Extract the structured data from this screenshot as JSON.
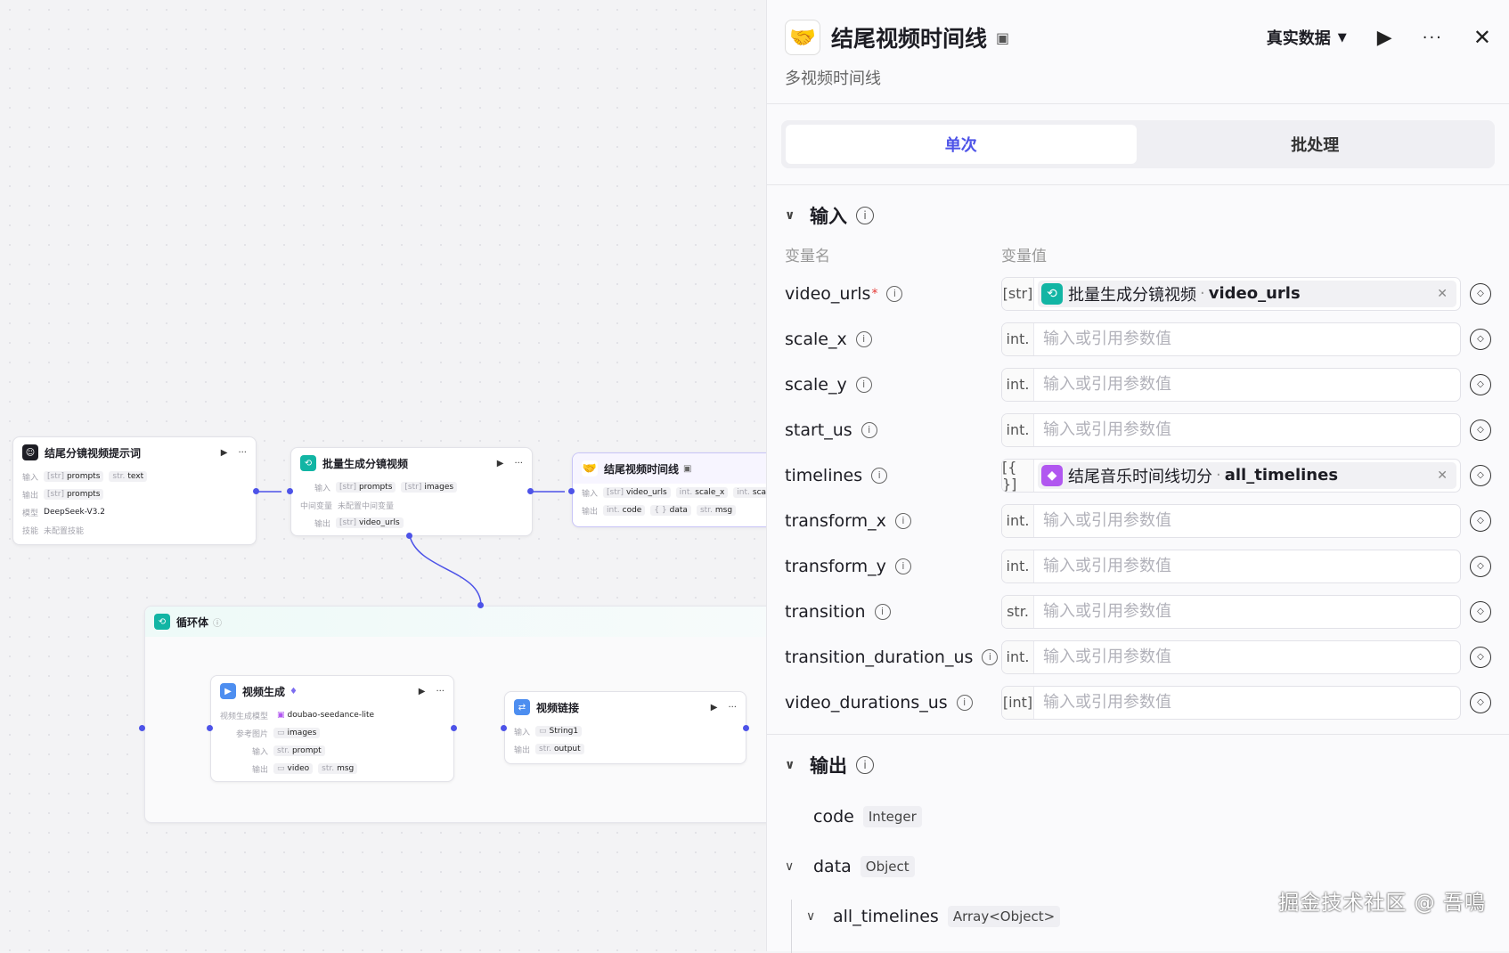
{
  "canvas": {
    "node_prompt": {
      "title": "结尾分镜视频提示词",
      "icon": "robot-icon",
      "input_label": "输入",
      "input_tag_type": "[str]",
      "input_tag": "prompts",
      "input_tag2_type": "str.",
      "input_tag2": "text",
      "output_label": "输出",
      "output_tag_type": "[str]",
      "output_tag": "prompts",
      "model_label": "模型",
      "model_value": "DeepSeek-V3.2",
      "skill_label": "技能",
      "skill_value": "未配置技能"
    },
    "node_batch": {
      "title": "批量生成分镜视频",
      "input_label": "输入",
      "input_tag_type": "[str]",
      "input_tag": "prompts",
      "input_tag2_type": "[str]",
      "input_tag2": "images",
      "mid_label": "中间变量",
      "mid_value": "未配置中间变量",
      "output_label": "输出",
      "output_tag_type": "[str]",
      "output_tag": "video_urls"
    },
    "node_timeline": {
      "title": "结尾视频时间线",
      "input_label": "输入",
      "t1_type": "[str]",
      "t1": "video_urls",
      "t2_type": "int.",
      "t2": "scale_x",
      "t3_type": "int.",
      "t3": "scale_y",
      "output_label": "输出",
      "o1_type": "int.",
      "o1": "code",
      "o2_type": "{ }",
      "o2": "data",
      "o3_type": "str.",
      "o3": "msg"
    },
    "loop": {
      "title": "循环体"
    },
    "node_video": {
      "title": "视频生成",
      "model_label": "视频生成模型",
      "model_value": "doubao-seedance-lite",
      "ref_label": "参考图片",
      "ref_value": "images",
      "input_label": "输入",
      "input_tag_type": "str.",
      "input_tag": "prompt",
      "output_label": "输出",
      "o1": "video",
      "o2_type": "str.",
      "o2": "msg"
    },
    "node_link": {
      "title": "视频链接",
      "input_label": "输入",
      "input_tag": "String1",
      "output_label": "输出",
      "output_tag_type": "str.",
      "output_tag": "output"
    },
    "play_glyph": "▶",
    "more_glyph": "···"
  },
  "panel": {
    "title": "结尾视频时间线",
    "subtitle": "多视频时间线",
    "data_mode": "真实数据",
    "tabs": [
      "单次",
      "批处理"
    ],
    "input_section": "输入",
    "col_name": "变量名",
    "col_value": "变量值",
    "placeholder": "输入或引用参数值",
    "variables": [
      {
        "name": "video_urls",
        "required": true,
        "type": "[str]",
        "ref": {
          "node": "批量生成分镜视频",
          "field": "video_urls",
          "color": "#12b5a4"
        }
      },
      {
        "name": "scale_x",
        "type": "int."
      },
      {
        "name": "scale_y",
        "type": "int."
      },
      {
        "name": "start_us",
        "type": "int."
      },
      {
        "name": "timelines",
        "type": "[{ }]",
        "ref": {
          "node": "结尾音乐时间线切分",
          "field": "all_timelines",
          "color": "#b157f0"
        }
      },
      {
        "name": "transform_x",
        "type": "int."
      },
      {
        "name": "transform_y",
        "type": "int."
      },
      {
        "name": "transition",
        "type": "str."
      },
      {
        "name": "transition_duration_us",
        "type": "int."
      },
      {
        "name": "video_durations_us",
        "type": "[int]"
      }
    ],
    "output_section": "输出",
    "outputs": [
      {
        "name": "code",
        "type": "Integer"
      },
      {
        "name": "data",
        "type": "Object"
      },
      {
        "name": "all_timelines",
        "type": "Array<Object>"
      }
    ]
  },
  "watermark": "掘金技术社区 @ 吾鳴",
  "colors": {
    "accent": "#4d53e8",
    "teal": "#12b5a4",
    "purple": "#b157f0"
  }
}
